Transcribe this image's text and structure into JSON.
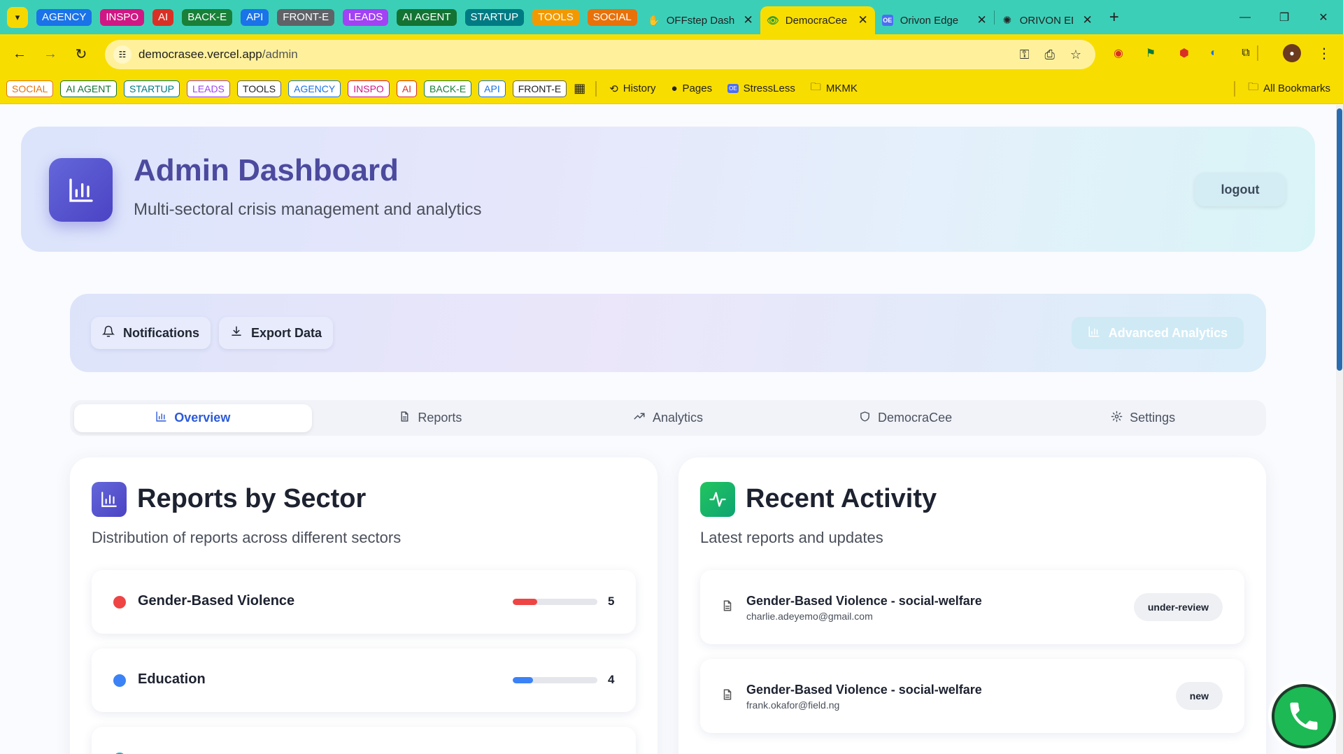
{
  "browser": {
    "tab_groups": [
      {
        "label": "AGENCY",
        "color": "#1a73e8"
      },
      {
        "label": "INSPO",
        "color": "#d01884"
      },
      {
        "label": "AI",
        "color": "#d93025"
      },
      {
        "label": "BACK-E",
        "color": "#188038"
      },
      {
        "label": "API",
        "color": "#1a73e8"
      },
      {
        "label": "FRONT-E",
        "color": "#5f6368"
      },
      {
        "label": "LEADS",
        "color": "#a142f4"
      },
      {
        "label": "AI AGENT",
        "color": "#137333"
      },
      {
        "label": "STARTUP",
        "color": "#007b83"
      },
      {
        "label": "TOOLS",
        "color": "#f29900"
      },
      {
        "label": "SOCIAL",
        "color": "#e8710a"
      }
    ],
    "tabs": [
      {
        "title": "OFFstep Dash",
        "favicon": "offstep-icon",
        "active": false
      },
      {
        "title": "DemocraCee",
        "favicon": "eye-icon",
        "active": true
      },
      {
        "title": "Orivon Edge",
        "favicon": "oe-icon",
        "active": false
      },
      {
        "title": "ORIVON EDGE",
        "favicon": "openai-icon",
        "active": false
      }
    ],
    "url_host": "democrasee.vercel.app",
    "url_path": "/admin",
    "bookmark_chips": [
      {
        "label": "SOCIAL",
        "color": "#e8710a"
      },
      {
        "label": "AI AGENT",
        "color": "#137333"
      },
      {
        "label": "STARTUP",
        "color": "#007b83"
      },
      {
        "label": "LEADS",
        "color": "#a142f4"
      },
      {
        "label": "TOOLS",
        "color": "#5f6368"
      },
      {
        "label": "AGENCY",
        "color": "#1a73e8"
      },
      {
        "label": "INSPO",
        "color": "#d01884"
      },
      {
        "label": "AI",
        "color": "#d93025"
      },
      {
        "label": "BACK-E",
        "color": "#188038"
      },
      {
        "label": "API",
        "color": "#1a73e8"
      },
      {
        "label": "FRONT-E",
        "color": "#5f6368"
      }
    ],
    "bookmark_links": [
      {
        "label": "History",
        "icon": "history-icon"
      },
      {
        "label": "Pages",
        "icon": "github-icon"
      },
      {
        "label": "StressLess",
        "icon": "oe-icon"
      },
      {
        "label": "MKMK",
        "icon": "folder-icon"
      }
    ],
    "all_bookmarks": "All Bookmarks"
  },
  "header": {
    "title": "Admin Dashboard",
    "subtitle": "Multi-sectoral crisis management and analytics",
    "logout_label": "logout"
  },
  "actions": {
    "notifications_label": "Notifications",
    "export_label": "Export Data",
    "advanced_label": "Advanced Analytics"
  },
  "tabs": [
    {
      "label": "Overview",
      "icon": "bar-chart-icon",
      "active": true
    },
    {
      "label": "Reports",
      "icon": "document-icon",
      "active": false
    },
    {
      "label": "Analytics",
      "icon": "trending-up-icon",
      "active": false
    },
    {
      "label": "DemocraCee",
      "icon": "shield-icon",
      "active": false
    },
    {
      "label": "Settings",
      "icon": "gear-icon",
      "active": false
    }
  ],
  "sectors_card": {
    "title": "Reports by Sector",
    "subtitle": "Distribution of reports across different sectors",
    "items": [
      {
        "name": "Gender-Based Violence",
        "count": "5",
        "color": "#ef4444",
        "fill_fraction": 0.29
      },
      {
        "name": "Education",
        "count": "4",
        "color": "#3b82f6",
        "fill_fraction": 0.24
      }
    ]
  },
  "activity_card": {
    "title": "Recent Activity",
    "subtitle": "Latest reports and updates",
    "items": [
      {
        "title": "Gender-Based Violence - social-welfare",
        "email": "charlie.adeyemo@gmail.com",
        "status": "under-review"
      },
      {
        "title": "Gender-Based Violence - social-welfare",
        "email": "frank.okafor@field.ng",
        "status": "new"
      }
    ]
  },
  "colors": {
    "accent_indigo": "#4b43c4",
    "activity_green": "#10b981",
    "active_tab_blue": "#2d5bd8"
  }
}
